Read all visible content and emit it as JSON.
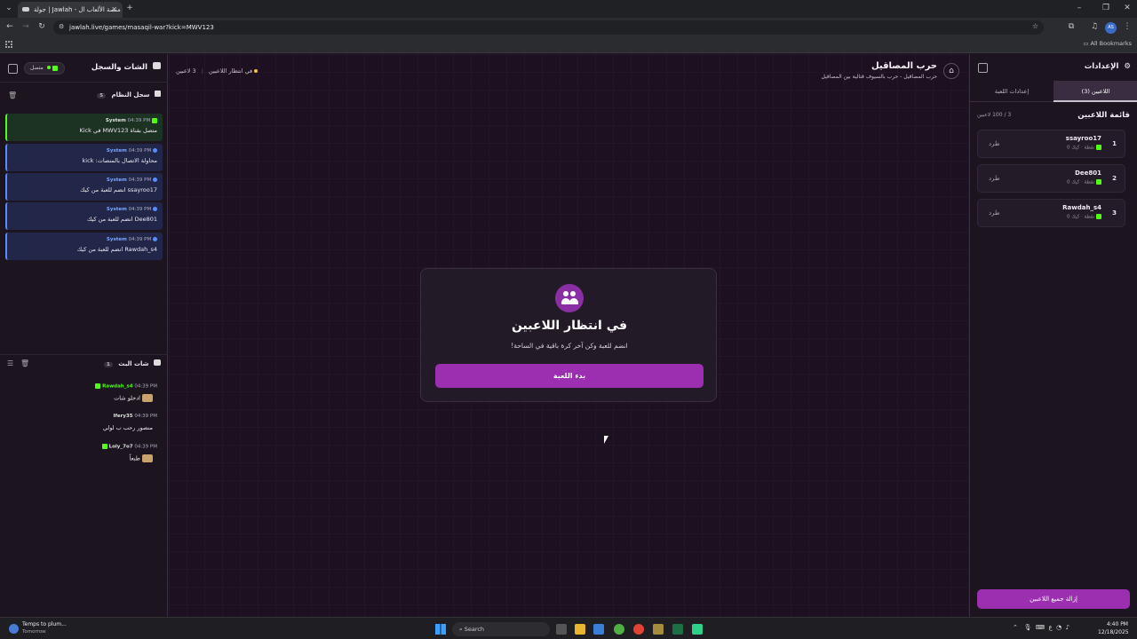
{
  "browser": {
    "tab_title": "جولة | Jawlah - منصة الألعاب ال",
    "url": "jawlah.live/games/masaqil-war?kick=MWV123",
    "bookmarks_label": "All Bookmarks",
    "profile_initials": "AS"
  },
  "left_panel": {
    "title": "الشات والسجل",
    "status_label": "متصل",
    "system_log": {
      "title": "سجل النظام",
      "count": "5",
      "messages": [
        {
          "user": "System",
          "time": "04:39 PM",
          "text": "متصل بقناة MWV123 في Kick"
        },
        {
          "user": "System",
          "time": "04:39 PM",
          "text": "محاولة الاتصال بالمنصات: kick"
        },
        {
          "user": "System",
          "time": "04:39 PM",
          "text": "ssayroo17 انضم للعبة من كيك"
        },
        {
          "user": "System",
          "time": "04:39 PM",
          "text": "Dee801 انضم للعبة من كيك"
        },
        {
          "user": "System",
          "time": "04:39 PM",
          "text": "Rawdah_s4 انضم للعبة من كيك"
        }
      ]
    },
    "live_chat": {
      "title": "شات البث",
      "count": "1",
      "messages": [
        {
          "user": "Rawdah_s4",
          "time": "04:39 PM",
          "text": "ادخلو شات",
          "emoji": true
        },
        {
          "user": "Ifery35",
          "time": "04:39 PM",
          "text": "منصور رحب ب لولي",
          "emoji": false
        },
        {
          "user": "Loly_7o7",
          "time": "04:39 PM",
          "text": "طبعاً",
          "emoji": true
        }
      ]
    }
  },
  "center": {
    "game_title": "حرب المصاقيل",
    "game_subtitle": "حرب المصاقيل - حرب بالسيوف قتالية بين المصاقيل",
    "players_status": "3 لاعبين",
    "waiting_status": "في انتظار اللاعبين",
    "card": {
      "title": "في انتظار اللاعبين",
      "subtitle": "انضم للعبة وكن آخر كرة باقية في الساحة!",
      "start_button": "بدء اللعبة"
    }
  },
  "right_panel": {
    "title": "الإعدادات",
    "tabs": [
      {
        "label": "اللاعبين (3)",
        "active": true
      },
      {
        "label": "إعدادات اللعبة",
        "active": false
      }
    ],
    "players_heading": "قائمة اللاعبين",
    "players_count": "3 / 100 لاعبين",
    "players": [
      {
        "rank": "1",
        "name": "ssayroo17",
        "platform": "كيك",
        "points": "0 نقطة",
        "kick_label": "طرد"
      },
      {
        "rank": "2",
        "name": "Dee801",
        "platform": "كيك",
        "points": "0 نقطة",
        "kick_label": "طرد"
      },
      {
        "rank": "3",
        "name": "Rawdah_s4",
        "platform": "كيك",
        "points": "0 نقطة",
        "kick_label": "طرد"
      }
    ],
    "remove_all_button": "إزالة جميع اللاعبين"
  },
  "taskbar": {
    "weather_title": "Temps to plum...",
    "weather_sub": "Tomorrow",
    "search_placeholder": "Search",
    "time": "4:40 PM",
    "date": "12/18/2025",
    "lang": "ع"
  },
  "colors": {
    "accent": "#9b2fb0",
    "kick_green": "#53fc18",
    "panel_bg": "#1c1520",
    "center_bg": "#1d1121"
  }
}
